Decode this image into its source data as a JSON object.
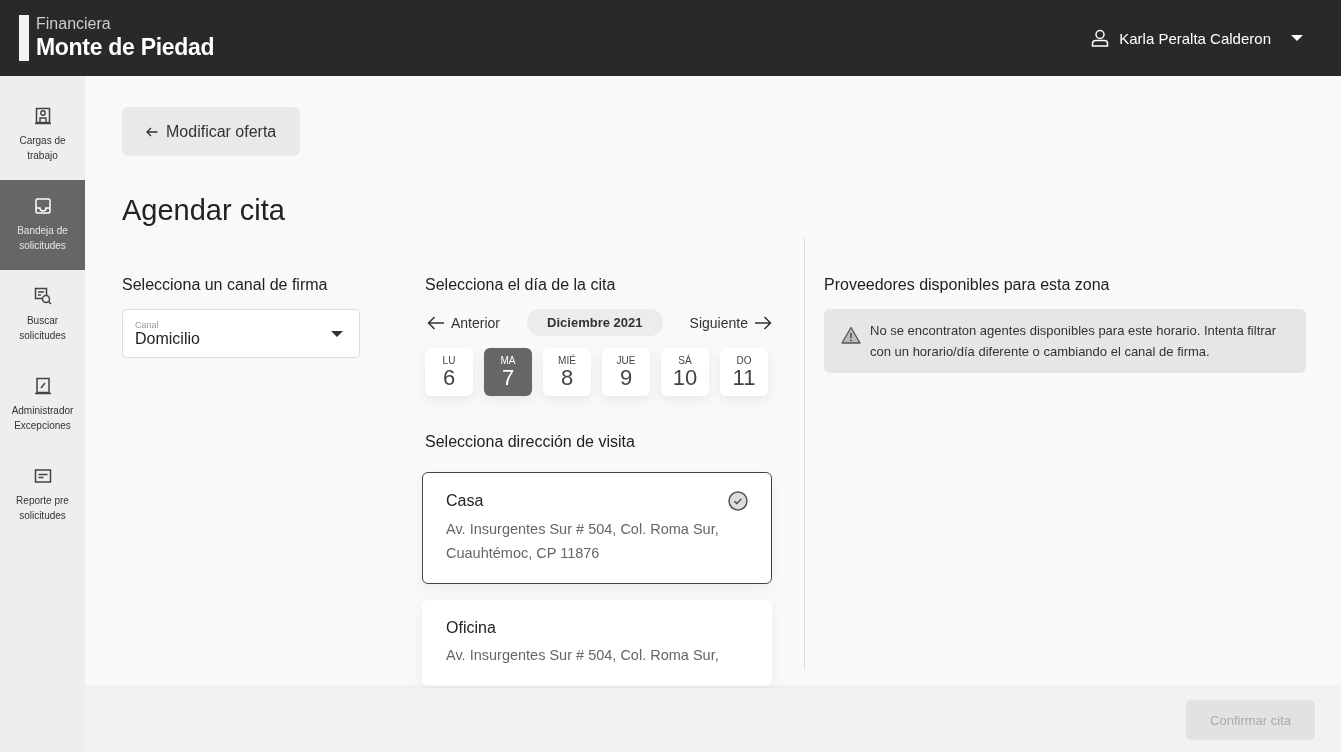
{
  "brand": {
    "small": "Financiera",
    "large": "Monte de Piedad"
  },
  "user": {
    "name": "Karla Peralta Calderon"
  },
  "sidebar": {
    "items": [
      {
        "label": "Cargas de trabajo",
        "selected": false
      },
      {
        "label": "Bandeja de solicitudes",
        "selected": true
      },
      {
        "label": "Buscar solicitudes",
        "selected": false
      },
      {
        "label": "Administrador Excepciones",
        "selected": false
      },
      {
        "label": "Reporte pre solicitudes",
        "selected": false
      }
    ]
  },
  "back_button": "Modificar oferta",
  "title": "Agendar cita",
  "channel": {
    "heading": "Selecciona un canal de firma",
    "label": "Canal",
    "value": "Domicilio"
  },
  "date": {
    "heading": "Selecciona el día de la cita",
    "prev": "Anterior",
    "month": "Diciembre 2021",
    "next": "Siguiente",
    "days": [
      {
        "weekday": "LU",
        "day": "6",
        "selected": false
      },
      {
        "weekday": "MA",
        "day": "7",
        "selected": true
      },
      {
        "weekday": "MIÉ",
        "day": "8",
        "selected": false
      },
      {
        "weekday": "JUE",
        "day": "9",
        "selected": false
      },
      {
        "weekday": "SÁ",
        "day": "10",
        "selected": false
      },
      {
        "weekday": "DO",
        "day": "11",
        "selected": false
      }
    ]
  },
  "address": {
    "heading": "Selecciona dirección de visita",
    "items": [
      {
        "name": "Casa",
        "lines": [
          "Av. Insurgentes Sur # 504, Col. Roma Sur,",
          "Cuauhtémoc, CP 11876"
        ],
        "selected": true
      },
      {
        "name": "Oficina",
        "lines": [
          "Av. Insurgentes Sur # 504, Col. Roma Sur,"
        ],
        "selected": false
      }
    ]
  },
  "providers": {
    "heading": "Proveedores disponibles para esta zona",
    "message": "No se encontraton agentes disponibles para este horario. Intenta filtrar con un horario/día diferente o cambiando el canal de firma."
  },
  "confirm": {
    "label": "Confirmar cita",
    "disabled": true
  }
}
